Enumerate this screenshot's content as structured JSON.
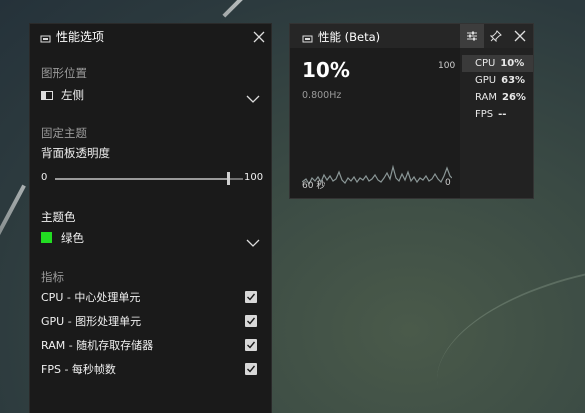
{
  "options_panel": {
    "title": "性能选项",
    "graph_position": {
      "label": "图形位置",
      "value": "左侧"
    },
    "pin_theme": {
      "label": "固定主题",
      "transparency_label": "背面板透明度",
      "min": "0",
      "max": "100",
      "value": 92
    },
    "theme_color": {
      "label": "主题色",
      "value": "绿色",
      "swatch": "#22dd22"
    },
    "metrics": {
      "label": "指标",
      "items": [
        {
          "label": "CPU - 中心处理单元",
          "checked": true
        },
        {
          "label": "GPU - 图形处理单元",
          "checked": true
        },
        {
          "label": "RAM - 随机存取存储器",
          "checked": true
        },
        {
          "label": "FPS - 每秒帧数",
          "checked": true
        }
      ]
    }
  },
  "perf_widget": {
    "title": "性能 (Beta)",
    "big_value": "10%",
    "sub_value": "0.800Hz",
    "scale_max": "100",
    "time_left": "60 秒",
    "time_right": "0",
    "metrics": [
      {
        "name": "CPU",
        "value": "10%"
      },
      {
        "name": "GPU",
        "value": "63%"
      },
      {
        "name": "RAM",
        "value": "26%"
      },
      {
        "name": "FPS",
        "value": "--"
      }
    ]
  },
  "icons": {
    "widget": "widget-icon",
    "close": "close-icon",
    "settings": "sliders-icon",
    "pin": "pin-icon",
    "chevron": "chevron-down-icon",
    "check": "checkmark-icon"
  }
}
